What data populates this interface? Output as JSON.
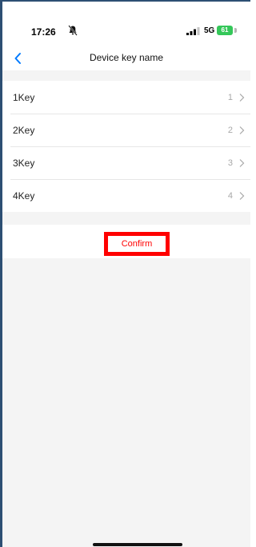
{
  "status_bar": {
    "time": "17:26",
    "network": "5G",
    "battery": "61"
  },
  "nav": {
    "title": "Device key name",
    "back_icon": "chevron-left-icon"
  },
  "keys": [
    {
      "label": "1Key",
      "value": "1"
    },
    {
      "label": "2Key",
      "value": "2"
    },
    {
      "label": "3Key",
      "value": "3"
    },
    {
      "label": "4Key",
      "value": "4"
    }
  ],
  "confirm_label": "Confirm",
  "colors": {
    "accent": "#007aff",
    "confirm": "#ff0000",
    "battery": "#34c759",
    "background": "#f4f4f4"
  }
}
